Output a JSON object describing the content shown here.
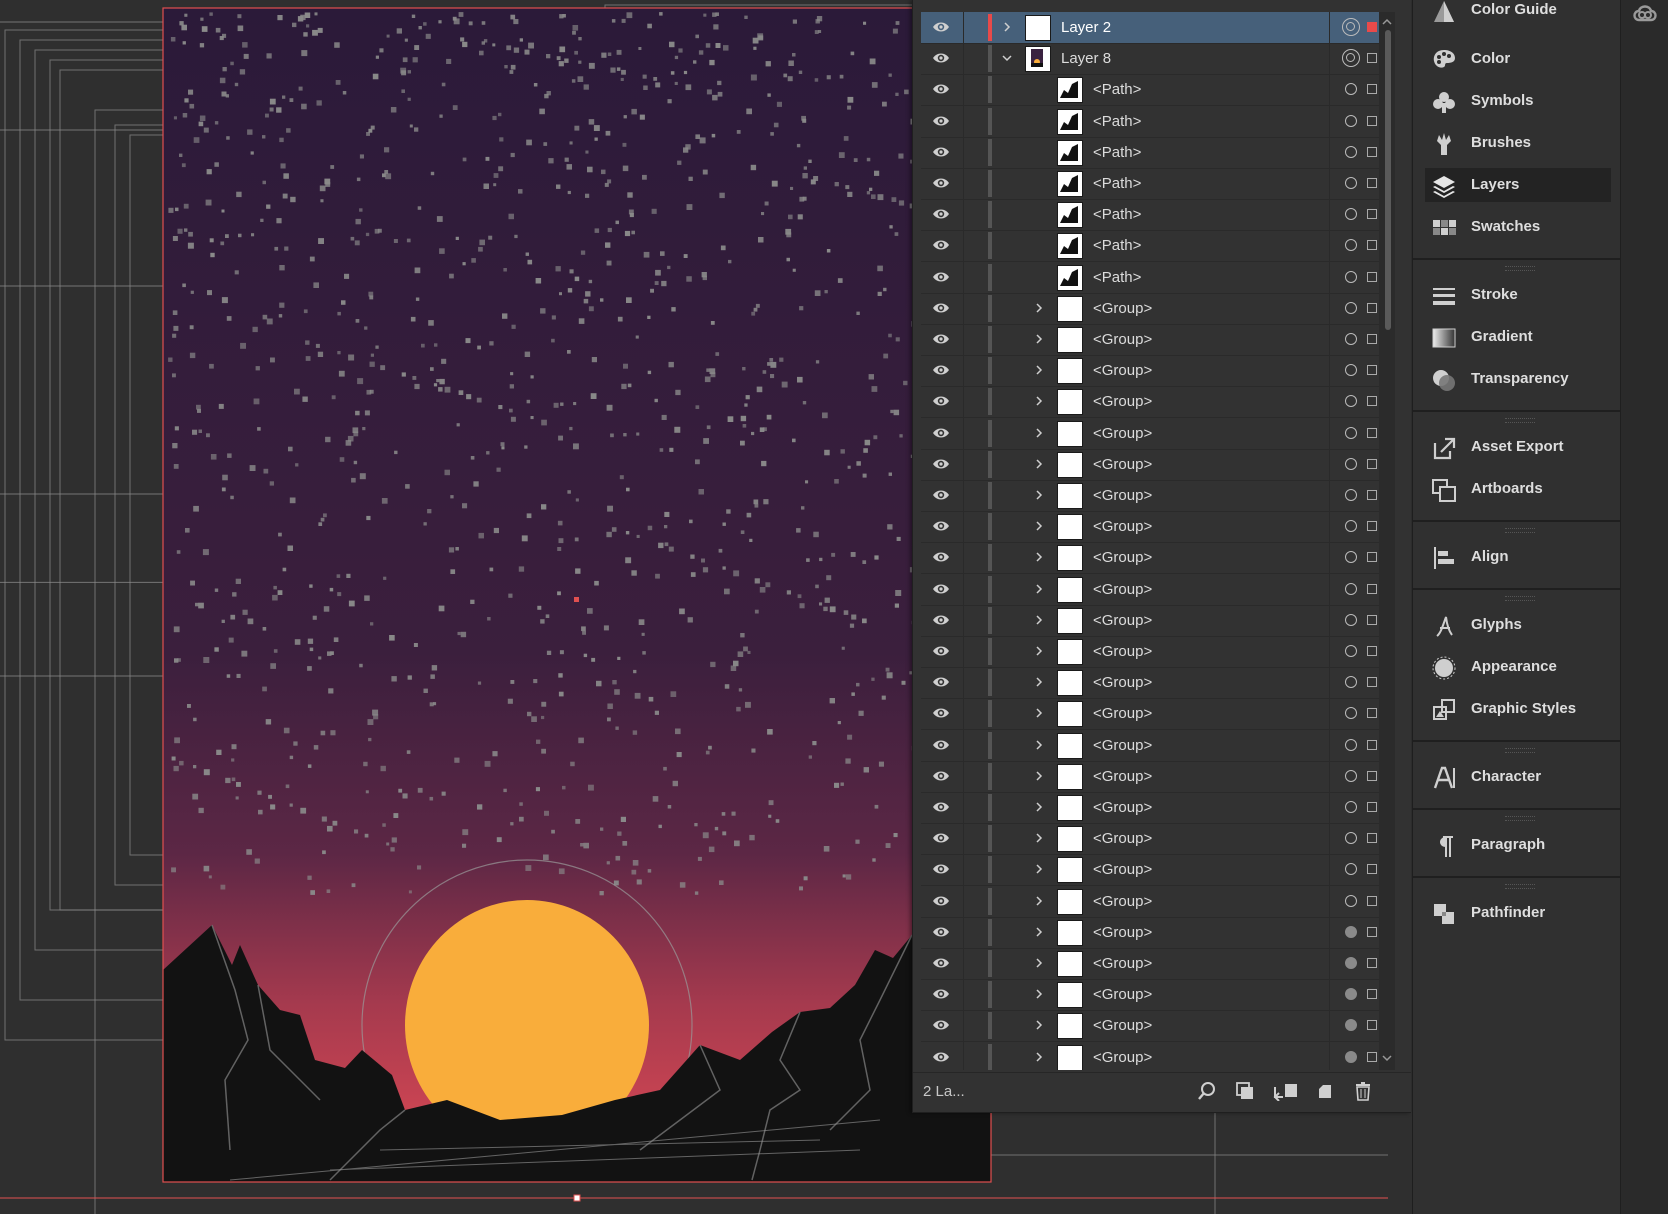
{
  "layers_panel": {
    "layer_count_label": "2 La...",
    "rows": [
      {
        "name": "Layer 2",
        "level": 0,
        "expand": "right",
        "selected": true,
        "target": "double",
        "select_color": "red",
        "thumb": "blank"
      },
      {
        "name": "Layer 8",
        "level": 0,
        "expand": "down",
        "selected": false,
        "target": "double",
        "select_color": "none",
        "thumb": "art"
      },
      {
        "name": "<Path>",
        "level": 1,
        "expand": "none",
        "target": "single",
        "thumb": "path"
      },
      {
        "name": "<Path>",
        "level": 1,
        "expand": "none",
        "target": "single",
        "thumb": "path"
      },
      {
        "name": "<Path>",
        "level": 1,
        "expand": "none",
        "target": "single",
        "thumb": "path"
      },
      {
        "name": "<Path>",
        "level": 1,
        "expand": "none",
        "target": "single",
        "thumb": "path"
      },
      {
        "name": "<Path>",
        "level": 1,
        "expand": "none",
        "target": "single",
        "thumb": "path"
      },
      {
        "name": "<Path>",
        "level": 1,
        "expand": "none",
        "target": "single",
        "thumb": "path"
      },
      {
        "name": "<Path>",
        "level": 1,
        "expand": "none",
        "target": "single",
        "thumb": "path"
      },
      {
        "name": "<Group>",
        "level": 1,
        "expand": "right",
        "target": "single",
        "thumb": "blank"
      },
      {
        "name": "<Group>",
        "level": 1,
        "expand": "right",
        "target": "single",
        "thumb": "blank"
      },
      {
        "name": "<Group>",
        "level": 1,
        "expand": "right",
        "target": "single",
        "thumb": "blank"
      },
      {
        "name": "<Group>",
        "level": 1,
        "expand": "right",
        "target": "single",
        "thumb": "blank"
      },
      {
        "name": "<Group>",
        "level": 1,
        "expand": "right",
        "target": "single",
        "thumb": "blank"
      },
      {
        "name": "<Group>",
        "level": 1,
        "expand": "right",
        "target": "single",
        "thumb": "blank"
      },
      {
        "name": "<Group>",
        "level": 1,
        "expand": "right",
        "target": "single",
        "thumb": "blank"
      },
      {
        "name": "<Group>",
        "level": 1,
        "expand": "right",
        "target": "single",
        "thumb": "blank"
      },
      {
        "name": "<Group>",
        "level": 1,
        "expand": "right",
        "target": "single",
        "thumb": "blank"
      },
      {
        "name": "<Group>",
        "level": 1,
        "expand": "right",
        "target": "single",
        "thumb": "blank"
      },
      {
        "name": "<Group>",
        "level": 1,
        "expand": "right",
        "target": "single",
        "thumb": "blank"
      },
      {
        "name": "<Group>",
        "level": 1,
        "expand": "right",
        "target": "single",
        "thumb": "blank"
      },
      {
        "name": "<Group>",
        "level": 1,
        "expand": "right",
        "target": "single",
        "thumb": "blank"
      },
      {
        "name": "<Group>",
        "level": 1,
        "expand": "right",
        "target": "single",
        "thumb": "blank"
      },
      {
        "name": "<Group>",
        "level": 1,
        "expand": "right",
        "target": "single",
        "thumb": "blank"
      },
      {
        "name": "<Group>",
        "level": 1,
        "expand": "right",
        "target": "single",
        "thumb": "blank"
      },
      {
        "name": "<Group>",
        "level": 1,
        "expand": "right",
        "target": "single",
        "thumb": "blank"
      },
      {
        "name": "<Group>",
        "level": 1,
        "expand": "right",
        "target": "single",
        "thumb": "blank"
      },
      {
        "name": "<Group>",
        "level": 1,
        "expand": "right",
        "target": "single",
        "thumb": "blank"
      },
      {
        "name": "<Group>",
        "level": 1,
        "expand": "right",
        "target": "single",
        "thumb": "blank"
      },
      {
        "name": "<Group>",
        "level": 1,
        "expand": "right",
        "target": "filled",
        "thumb": "blank"
      },
      {
        "name": "<Group>",
        "level": 1,
        "expand": "right",
        "target": "filled",
        "thumb": "blank"
      },
      {
        "name": "<Group>",
        "level": 1,
        "expand": "right",
        "target": "filled",
        "thumb": "blank"
      },
      {
        "name": "<Group>",
        "level": 1,
        "expand": "right",
        "target": "filled",
        "thumb": "blank"
      },
      {
        "name": "<Group>",
        "level": 1,
        "expand": "right",
        "target": "filled",
        "thumb": "blank"
      }
    ],
    "footer_icons": [
      "locate-object-icon",
      "make-clipping-mask-icon",
      "create-sublayer-icon",
      "create-new-layer-icon",
      "delete-layer-icon"
    ]
  },
  "dock": {
    "groups": [
      [
        {
          "label": "Color Guide",
          "icon": "color-guide-icon"
        },
        {
          "label": "Color",
          "icon": "color-palette-icon"
        },
        {
          "label": "Symbols",
          "icon": "symbols-club-icon"
        },
        {
          "label": "Brushes",
          "icon": "brushes-icon"
        },
        {
          "label": "Layers",
          "icon": "layers-icon",
          "active": true
        },
        {
          "label": "Swatches",
          "icon": "swatches-grid-icon"
        }
      ],
      [
        {
          "label": "Stroke",
          "icon": "stroke-lines-icon"
        },
        {
          "label": "Gradient",
          "icon": "gradient-icon"
        },
        {
          "label": "Transparency",
          "icon": "transparency-circles-icon"
        }
      ],
      [
        {
          "label": "Asset Export",
          "icon": "asset-export-icon"
        },
        {
          "label": "Artboards",
          "icon": "artboards-icon"
        }
      ],
      [
        {
          "label": "Align",
          "icon": "align-icon"
        }
      ],
      [
        {
          "label": "Glyphs",
          "icon": "glyphs-icon"
        },
        {
          "label": "Appearance",
          "icon": "appearance-icon"
        },
        {
          "label": "Graphic Styles",
          "icon": "graphic-styles-icon"
        }
      ],
      [
        {
          "label": "Character",
          "icon": "character-icon"
        }
      ],
      [
        {
          "label": "Paragraph",
          "icon": "paragraph-icon"
        }
      ],
      [
        {
          "label": "Pathfinder",
          "icon": "pathfinder-icon"
        }
      ]
    ]
  },
  "artwork": {
    "sky_top_color": "#2c1a3a",
    "sky_mid_color": "#4a2340",
    "sky_bottom_color": "#e04a55",
    "sun_color": "#f9ad3b",
    "mountain_color": "#121212",
    "star_color": "#8a8a8a",
    "guide_color": "#8c8c8c",
    "artboard_edge_color": "#e05050"
  },
  "app": {
    "creative_cloud_icon": "creative-cloud-icon"
  }
}
